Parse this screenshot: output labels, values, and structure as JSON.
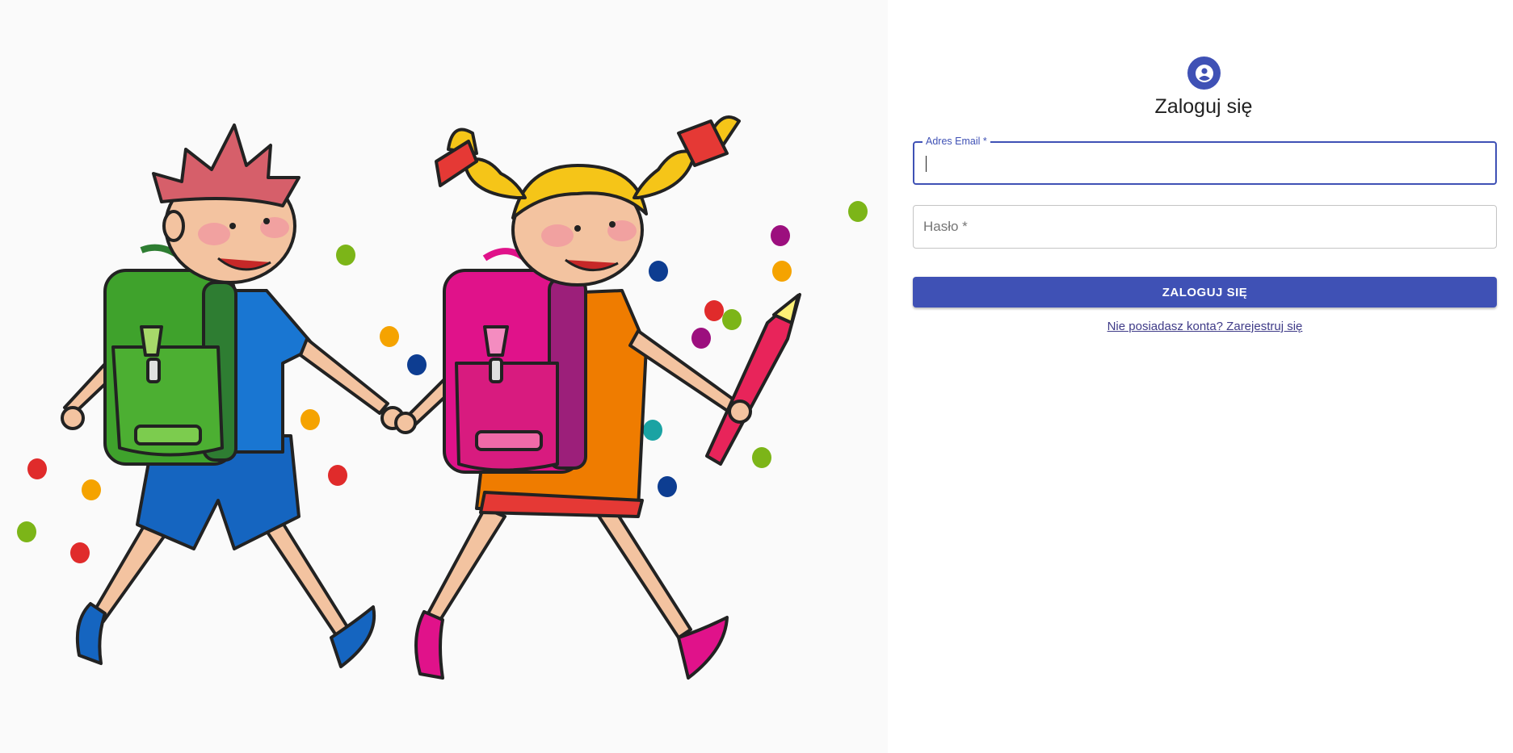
{
  "hero": {
    "illustration": "two-children-walking-with-school-backpacks",
    "colors": {
      "boy_backpack": "#3fa22c",
      "girl_backpack": "#e0128a",
      "boy_clothes": "#1565c0",
      "girl_dress": "#ef7c00",
      "boy_hair": "#d65f6a",
      "girl_hair": "#f5c518",
      "pencil": "#e8245a"
    }
  },
  "login": {
    "icon": "account-circle-icon",
    "title": "Zaloguj się",
    "email_label": "Adres Email *",
    "email_value": "",
    "password_placeholder": "Hasło *",
    "password_value": "",
    "submit_label": "ZALOGUJ SIĘ",
    "register_link": "Nie posiadasz konta? Zarejestruj się"
  },
  "theme": {
    "primary": "#3f51b5",
    "link": "#3f3b88",
    "outline": "#c4c4c4"
  }
}
